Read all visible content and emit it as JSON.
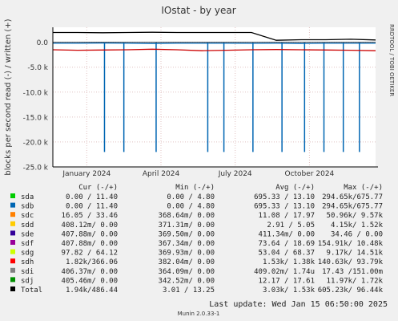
{
  "chart_data": {
    "type": "line",
    "title": "IOstat - by year",
    "ylabel": "blocks per second read (-) / written (+)",
    "side_label": "RRDTOOL / TOBI OETIKER",
    "xlabel": "",
    "ylim": [
      -25000,
      3000
    ],
    "y_ticks": [
      {
        "value": 0,
        "label": "0.0"
      },
      {
        "value": -5000,
        "label": "-5.0 k"
      },
      {
        "value": -10000,
        "label": "-10.0 k"
      },
      {
        "value": -15000,
        "label": "-15.0 k"
      },
      {
        "value": -20000,
        "label": "-20.0 k"
      },
      {
        "value": -25000,
        "label": "-25.0 k"
      }
    ],
    "x_ticks": [
      {
        "pos": 0.105,
        "label": "January 2024"
      },
      {
        "pos": 0.335,
        "label": "April 2024"
      },
      {
        "pos": 0.565,
        "label": "July 2024"
      },
      {
        "pos": 0.795,
        "label": "October 2024"
      }
    ],
    "x": [
      "2023-12",
      "2024-01",
      "2024-02",
      "2024-03",
      "2024-04",
      "2024-05",
      "2024-06",
      "2024-07",
      "2024-08",
      "2024-09",
      "2024-10",
      "2024-11",
      "2024-12",
      "2025-01"
    ],
    "series": [
      {
        "name": "sdb",
        "color": "#0066b3",
        "values": [
          -200,
          -200,
          -150,
          -200,
          -250,
          -200,
          -200,
          -200,
          -220,
          -200,
          -250,
          -200,
          -200,
          -200
        ]
      },
      {
        "name": "sdh",
        "color": "#cc0000",
        "values": [
          -1500,
          -1600,
          -1550,
          -1500,
          -1400,
          -1500,
          -1700,
          -1600,
          -1500,
          -1450,
          -1500,
          -1550,
          -1600,
          -1700
        ]
      },
      {
        "name": "Total",
        "color": "#000000",
        "values": [
          1950,
          1950,
          1900,
          1950,
          2000,
          1950,
          1950,
          1950,
          1950,
          400,
          500,
          500,
          600,
          450
        ]
      }
    ],
    "spikes": [
      {
        "name": "sdb",
        "color": "#0066b3",
        "x": [
          0.16,
          0.22,
          0.32,
          0.48,
          0.53,
          0.62,
          0.71,
          0.78,
          0.84,
          0.9,
          0.95
        ],
        "values": [
          -22000,
          -22000,
          -22000,
          -22000,
          -22000,
          -22000,
          -22000,
          -22000,
          -22000,
          -22000,
          -22000
        ]
      }
    ],
    "legend_header": [
      "Cur (-/+)",
      "Min (-/+)",
      "Avg (-/+)",
      "Max (-/+)"
    ],
    "legend": [
      {
        "name": "sda",
        "color": "#00cc00",
        "cur": "0.00 / 11.40",
        "min": "0.00 /  4.80",
        "avg": "695.33 / 13.10",
        "max": "294.65k/675.77"
      },
      {
        "name": "sdb",
        "color": "#0066b3",
        "cur": "0.00 / 11.40",
        "min": "0.00 /  4.80",
        "avg": "695.33 / 13.10",
        "max": "294.65k/675.77"
      },
      {
        "name": "sdc",
        "color": "#ff8000",
        "cur": "16.05 / 33.46",
        "min": "368.64m/  0.00",
        "avg": "11.08 / 17.97",
        "max": "50.96k/  9.57k"
      },
      {
        "name": "sdd",
        "color": "#ffcc00",
        "cur": "408.12m/  0.00",
        "min": "371.31m/  0.00",
        "avg": "2.91 /  5.05",
        "max": "4.15k/  1.52k"
      },
      {
        "name": "sde",
        "color": "#330099",
        "cur": "407.88m/  0.00",
        "min": "369.50m/  0.00",
        "avg": "411.34m/  0.00",
        "max": "34.46 /  0.00"
      },
      {
        "name": "sdf",
        "color": "#990099",
        "cur": "407.88m/  0.00",
        "min": "367.34m/  0.00",
        "avg": "73.64 / 18.69",
        "max": "154.91k/ 10.48k"
      },
      {
        "name": "sdg",
        "color": "#ccff00",
        "cur": "97.82 / 64.12",
        "min": "369.93m/  0.00",
        "avg": "53.04 / 68.37",
        "max": "9.17k/ 14.51k"
      },
      {
        "name": "sdh",
        "color": "#ff0000",
        "cur": "1.82k/366.06",
        "min": "382.04m/  0.00",
        "avg": "1.53k/  1.38k",
        "max": "140.63k/ 93.79k"
      },
      {
        "name": "sdi",
        "color": "#808080",
        "cur": "406.37m/  0.00",
        "min": "364.09m/  0.00",
        "avg": "409.02m/  1.74u",
        "max": "17.43 /151.00m"
      },
      {
        "name": "sdj",
        "color": "#008f00",
        "cur": "405.46m/  0.00",
        "min": "342.52m/  0.00",
        "avg": "12.17 / 17.61",
        "max": "11.97k/  1.72k"
      },
      {
        "name": "Total",
        "color": "#000000",
        "cur": "1.94k/486.44",
        "min": "3.01 / 13.25",
        "avg": "3.03k/  1.53k",
        "max": "605.23k/ 96.44k"
      }
    ],
    "last_update": "Last update:  Wed Jan 15 06:50:00 2025",
    "footer": "Munin 2.0.33-1",
    "grid": true
  }
}
